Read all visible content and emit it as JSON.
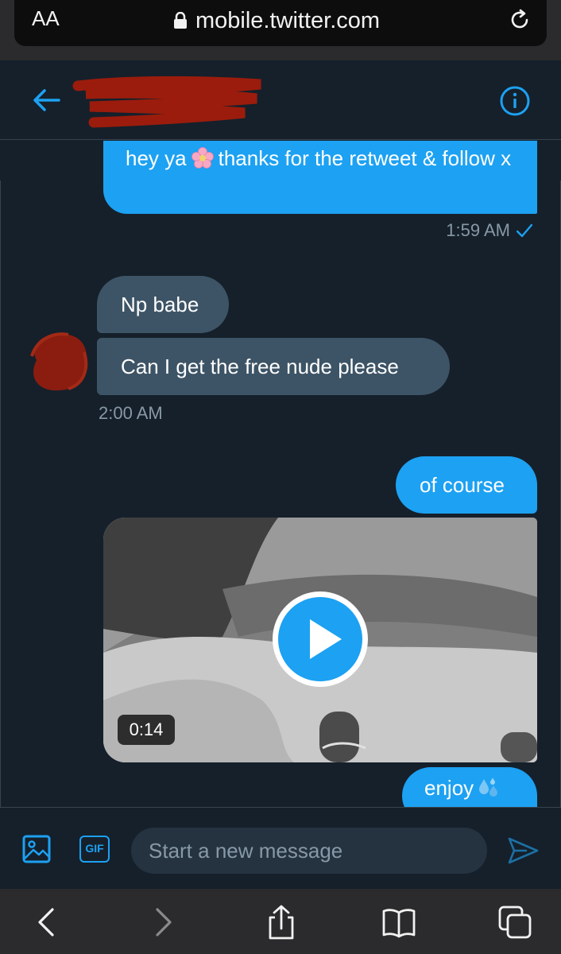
{
  "browser": {
    "text_size_label": "AA",
    "url": "mobile.twitter.com",
    "toolbar_icons": [
      "back-icon",
      "forward-icon",
      "share-icon",
      "bookmarks-icon",
      "tabs-icon"
    ]
  },
  "dm_header": {
    "icons": [
      "back-arrow-icon",
      "info-icon"
    ],
    "recipient_name_redacted": true
  },
  "messages": [
    {
      "direction": "out",
      "text_before_emoji": "hey ya",
      "emoji": "cherry-blossom",
      "text_after_emoji": "thanks for the retweet & follow x"
    },
    {
      "direction": "out",
      "timestamp": "1:59 AM",
      "status_icon": "checkmark-icon"
    },
    {
      "direction": "in",
      "text": "Np babe"
    },
    {
      "direction": "in",
      "text": "Can I get the free nude please"
    },
    {
      "direction": "in",
      "timestamp": "2:00 AM"
    },
    {
      "direction": "out",
      "text": "of course"
    },
    {
      "direction": "out",
      "type": "video",
      "duration": "0:14"
    },
    {
      "direction": "out",
      "text": "enjoy",
      "emoji": "sweat-droplets"
    }
  ],
  "composer": {
    "gif_label": "GIF",
    "placeholder": "Start a new message",
    "value": ""
  },
  "colors": {
    "background": "#15202b",
    "outgoing_bubble": "#1da1f2",
    "incoming_bubble": "#3d5466",
    "timestamp": "#8899a6",
    "accent": "#1da1f2"
  }
}
